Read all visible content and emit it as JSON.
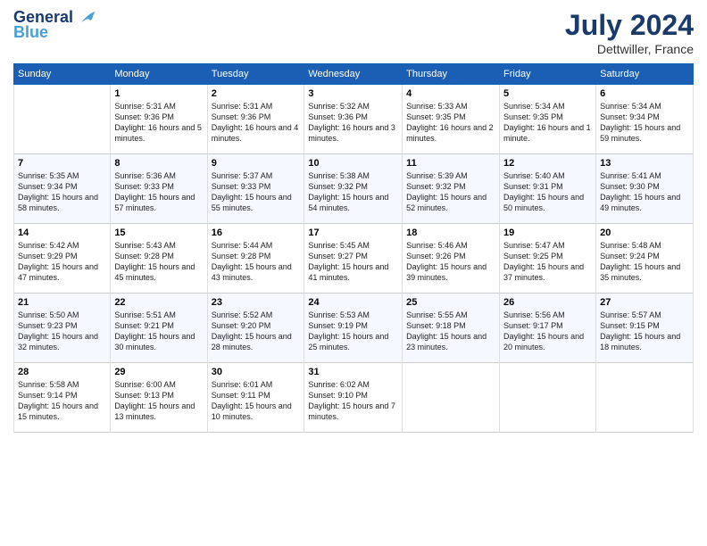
{
  "header": {
    "logo_line1": "General",
    "logo_line2": "Blue",
    "month": "July 2024",
    "location": "Dettwiller, France"
  },
  "weekdays": [
    "Sunday",
    "Monday",
    "Tuesday",
    "Wednesday",
    "Thursday",
    "Friday",
    "Saturday"
  ],
  "weeks": [
    [
      {
        "day": "",
        "sunrise": "",
        "sunset": "",
        "daylight": ""
      },
      {
        "day": "1",
        "sunrise": "Sunrise: 5:31 AM",
        "sunset": "Sunset: 9:36 PM",
        "daylight": "Daylight: 16 hours and 5 minutes."
      },
      {
        "day": "2",
        "sunrise": "Sunrise: 5:31 AM",
        "sunset": "Sunset: 9:36 PM",
        "daylight": "Daylight: 16 hours and 4 minutes."
      },
      {
        "day": "3",
        "sunrise": "Sunrise: 5:32 AM",
        "sunset": "Sunset: 9:36 PM",
        "daylight": "Daylight: 16 hours and 3 minutes."
      },
      {
        "day": "4",
        "sunrise": "Sunrise: 5:33 AM",
        "sunset": "Sunset: 9:35 PM",
        "daylight": "Daylight: 16 hours and 2 minutes."
      },
      {
        "day": "5",
        "sunrise": "Sunrise: 5:34 AM",
        "sunset": "Sunset: 9:35 PM",
        "daylight": "Daylight: 16 hours and 1 minute."
      },
      {
        "day": "6",
        "sunrise": "Sunrise: 5:34 AM",
        "sunset": "Sunset: 9:34 PM",
        "daylight": "Daylight: 15 hours and 59 minutes."
      }
    ],
    [
      {
        "day": "7",
        "sunrise": "Sunrise: 5:35 AM",
        "sunset": "Sunset: 9:34 PM",
        "daylight": "Daylight: 15 hours and 58 minutes."
      },
      {
        "day": "8",
        "sunrise": "Sunrise: 5:36 AM",
        "sunset": "Sunset: 9:33 PM",
        "daylight": "Daylight: 15 hours and 57 minutes."
      },
      {
        "day": "9",
        "sunrise": "Sunrise: 5:37 AM",
        "sunset": "Sunset: 9:33 PM",
        "daylight": "Daylight: 15 hours and 55 minutes."
      },
      {
        "day": "10",
        "sunrise": "Sunrise: 5:38 AM",
        "sunset": "Sunset: 9:32 PM",
        "daylight": "Daylight: 15 hours and 54 minutes."
      },
      {
        "day": "11",
        "sunrise": "Sunrise: 5:39 AM",
        "sunset": "Sunset: 9:32 PM",
        "daylight": "Daylight: 15 hours and 52 minutes."
      },
      {
        "day": "12",
        "sunrise": "Sunrise: 5:40 AM",
        "sunset": "Sunset: 9:31 PM",
        "daylight": "Daylight: 15 hours and 50 minutes."
      },
      {
        "day": "13",
        "sunrise": "Sunrise: 5:41 AM",
        "sunset": "Sunset: 9:30 PM",
        "daylight": "Daylight: 15 hours and 49 minutes."
      }
    ],
    [
      {
        "day": "14",
        "sunrise": "Sunrise: 5:42 AM",
        "sunset": "Sunset: 9:29 PM",
        "daylight": "Daylight: 15 hours and 47 minutes."
      },
      {
        "day": "15",
        "sunrise": "Sunrise: 5:43 AM",
        "sunset": "Sunset: 9:28 PM",
        "daylight": "Daylight: 15 hours and 45 minutes."
      },
      {
        "day": "16",
        "sunrise": "Sunrise: 5:44 AM",
        "sunset": "Sunset: 9:28 PM",
        "daylight": "Daylight: 15 hours and 43 minutes."
      },
      {
        "day": "17",
        "sunrise": "Sunrise: 5:45 AM",
        "sunset": "Sunset: 9:27 PM",
        "daylight": "Daylight: 15 hours and 41 minutes."
      },
      {
        "day": "18",
        "sunrise": "Sunrise: 5:46 AM",
        "sunset": "Sunset: 9:26 PM",
        "daylight": "Daylight: 15 hours and 39 minutes."
      },
      {
        "day": "19",
        "sunrise": "Sunrise: 5:47 AM",
        "sunset": "Sunset: 9:25 PM",
        "daylight": "Daylight: 15 hours and 37 minutes."
      },
      {
        "day": "20",
        "sunrise": "Sunrise: 5:48 AM",
        "sunset": "Sunset: 9:24 PM",
        "daylight": "Daylight: 15 hours and 35 minutes."
      }
    ],
    [
      {
        "day": "21",
        "sunrise": "Sunrise: 5:50 AM",
        "sunset": "Sunset: 9:23 PM",
        "daylight": "Daylight: 15 hours and 32 minutes."
      },
      {
        "day": "22",
        "sunrise": "Sunrise: 5:51 AM",
        "sunset": "Sunset: 9:21 PM",
        "daylight": "Daylight: 15 hours and 30 minutes."
      },
      {
        "day": "23",
        "sunrise": "Sunrise: 5:52 AM",
        "sunset": "Sunset: 9:20 PM",
        "daylight": "Daylight: 15 hours and 28 minutes."
      },
      {
        "day": "24",
        "sunrise": "Sunrise: 5:53 AM",
        "sunset": "Sunset: 9:19 PM",
        "daylight": "Daylight: 15 hours and 25 minutes."
      },
      {
        "day": "25",
        "sunrise": "Sunrise: 5:55 AM",
        "sunset": "Sunset: 9:18 PM",
        "daylight": "Daylight: 15 hours and 23 minutes."
      },
      {
        "day": "26",
        "sunrise": "Sunrise: 5:56 AM",
        "sunset": "Sunset: 9:17 PM",
        "daylight": "Daylight: 15 hours and 20 minutes."
      },
      {
        "day": "27",
        "sunrise": "Sunrise: 5:57 AM",
        "sunset": "Sunset: 9:15 PM",
        "daylight": "Daylight: 15 hours and 18 minutes."
      }
    ],
    [
      {
        "day": "28",
        "sunrise": "Sunrise: 5:58 AM",
        "sunset": "Sunset: 9:14 PM",
        "daylight": "Daylight: 15 hours and 15 minutes."
      },
      {
        "day": "29",
        "sunrise": "Sunrise: 6:00 AM",
        "sunset": "Sunset: 9:13 PM",
        "daylight": "Daylight: 15 hours and 13 minutes."
      },
      {
        "day": "30",
        "sunrise": "Sunrise: 6:01 AM",
        "sunset": "Sunset: 9:11 PM",
        "daylight": "Daylight: 15 hours and 10 minutes."
      },
      {
        "day": "31",
        "sunrise": "Sunrise: 6:02 AM",
        "sunset": "Sunset: 9:10 PM",
        "daylight": "Daylight: 15 hours and 7 minutes."
      },
      {
        "day": "",
        "sunrise": "",
        "sunset": "",
        "daylight": ""
      },
      {
        "day": "",
        "sunrise": "",
        "sunset": "",
        "daylight": ""
      },
      {
        "day": "",
        "sunrise": "",
        "sunset": "",
        "daylight": ""
      }
    ]
  ]
}
